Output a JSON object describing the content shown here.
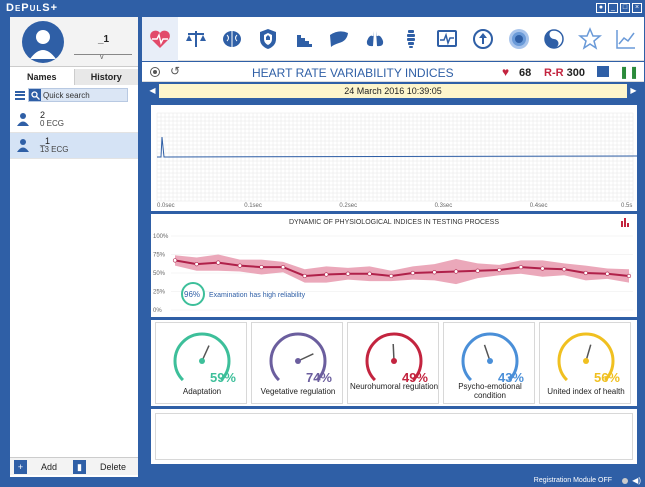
{
  "app": {
    "title": "DePulS+"
  },
  "window": {
    "buttons": [
      "restore",
      "minimize",
      "maximize",
      "close"
    ]
  },
  "profile": {
    "name": "_1"
  },
  "left_tabs": [
    "Names",
    "History"
  ],
  "search": {
    "placeholder": "Quick search"
  },
  "patients": [
    {
      "name": "2",
      "records": "0 ECG"
    },
    {
      "name": "_1",
      "records": "13 ECG"
    }
  ],
  "footer": {
    "add": "Add",
    "delete": "Delete"
  },
  "toolbar_icons": [
    "heart-rate-icon",
    "balance-icon",
    "brain-icon",
    "shield-icon",
    "stairs-icon",
    "liver-icon",
    "lungs-icon",
    "spine-icon",
    "ecg-monitor-icon",
    "upload-icon",
    "target-icon",
    "yin-yang-icon",
    "star-icon",
    "line-graph-icon"
  ],
  "header": {
    "title": "HEART RATE VARIABILITY INDICES",
    "hr": "68",
    "rr_label": "R-R",
    "rr_value": "300"
  },
  "date": "24 March 2016 10:39:05",
  "ecg_axis": [
    "0.0sec",
    "0.1sec",
    "0.2sec",
    "0.3sec",
    "0.4sec",
    "0.5s"
  ],
  "dynamic": {
    "title": "DYNAMIC OF PHYSIOLOGICAL INDICES IN TESTING PROCESS",
    "y_ticks": [
      "100%",
      "75%",
      "50%",
      "25%",
      "0%"
    ],
    "reliability_pct": "96%",
    "reliability_text": "Examination has high reliability",
    "series": [
      0.67,
      0.62,
      0.64,
      0.6,
      0.58,
      0.58,
      0.46,
      0.48,
      0.49,
      0.49,
      0.46,
      0.5,
      0.51,
      0.52,
      0.53,
      0.54,
      0.58,
      0.56,
      0.55,
      0.5,
      0.49,
      0.46
    ]
  },
  "gauges": [
    {
      "value": "59%",
      "pct": 0.59,
      "label": "Adaptation",
      "color": "#3dbf9a"
    },
    {
      "value": "74%",
      "pct": 0.74,
      "label": "Vegetative regulation",
      "color": "#6b5e9e"
    },
    {
      "value": "49%",
      "pct": 0.49,
      "label": "Neurohumoral regulation",
      "color": "#c3243f"
    },
    {
      "value": "43%",
      "pct": 0.43,
      "label": "Psycho-emotional condition",
      "color": "#4a8fd8"
    },
    {
      "value": "56%",
      "pct": 0.56,
      "label": "United index of health",
      "color": "#f0c020"
    }
  ],
  "status": {
    "registration": "Registration Module OFF"
  }
}
